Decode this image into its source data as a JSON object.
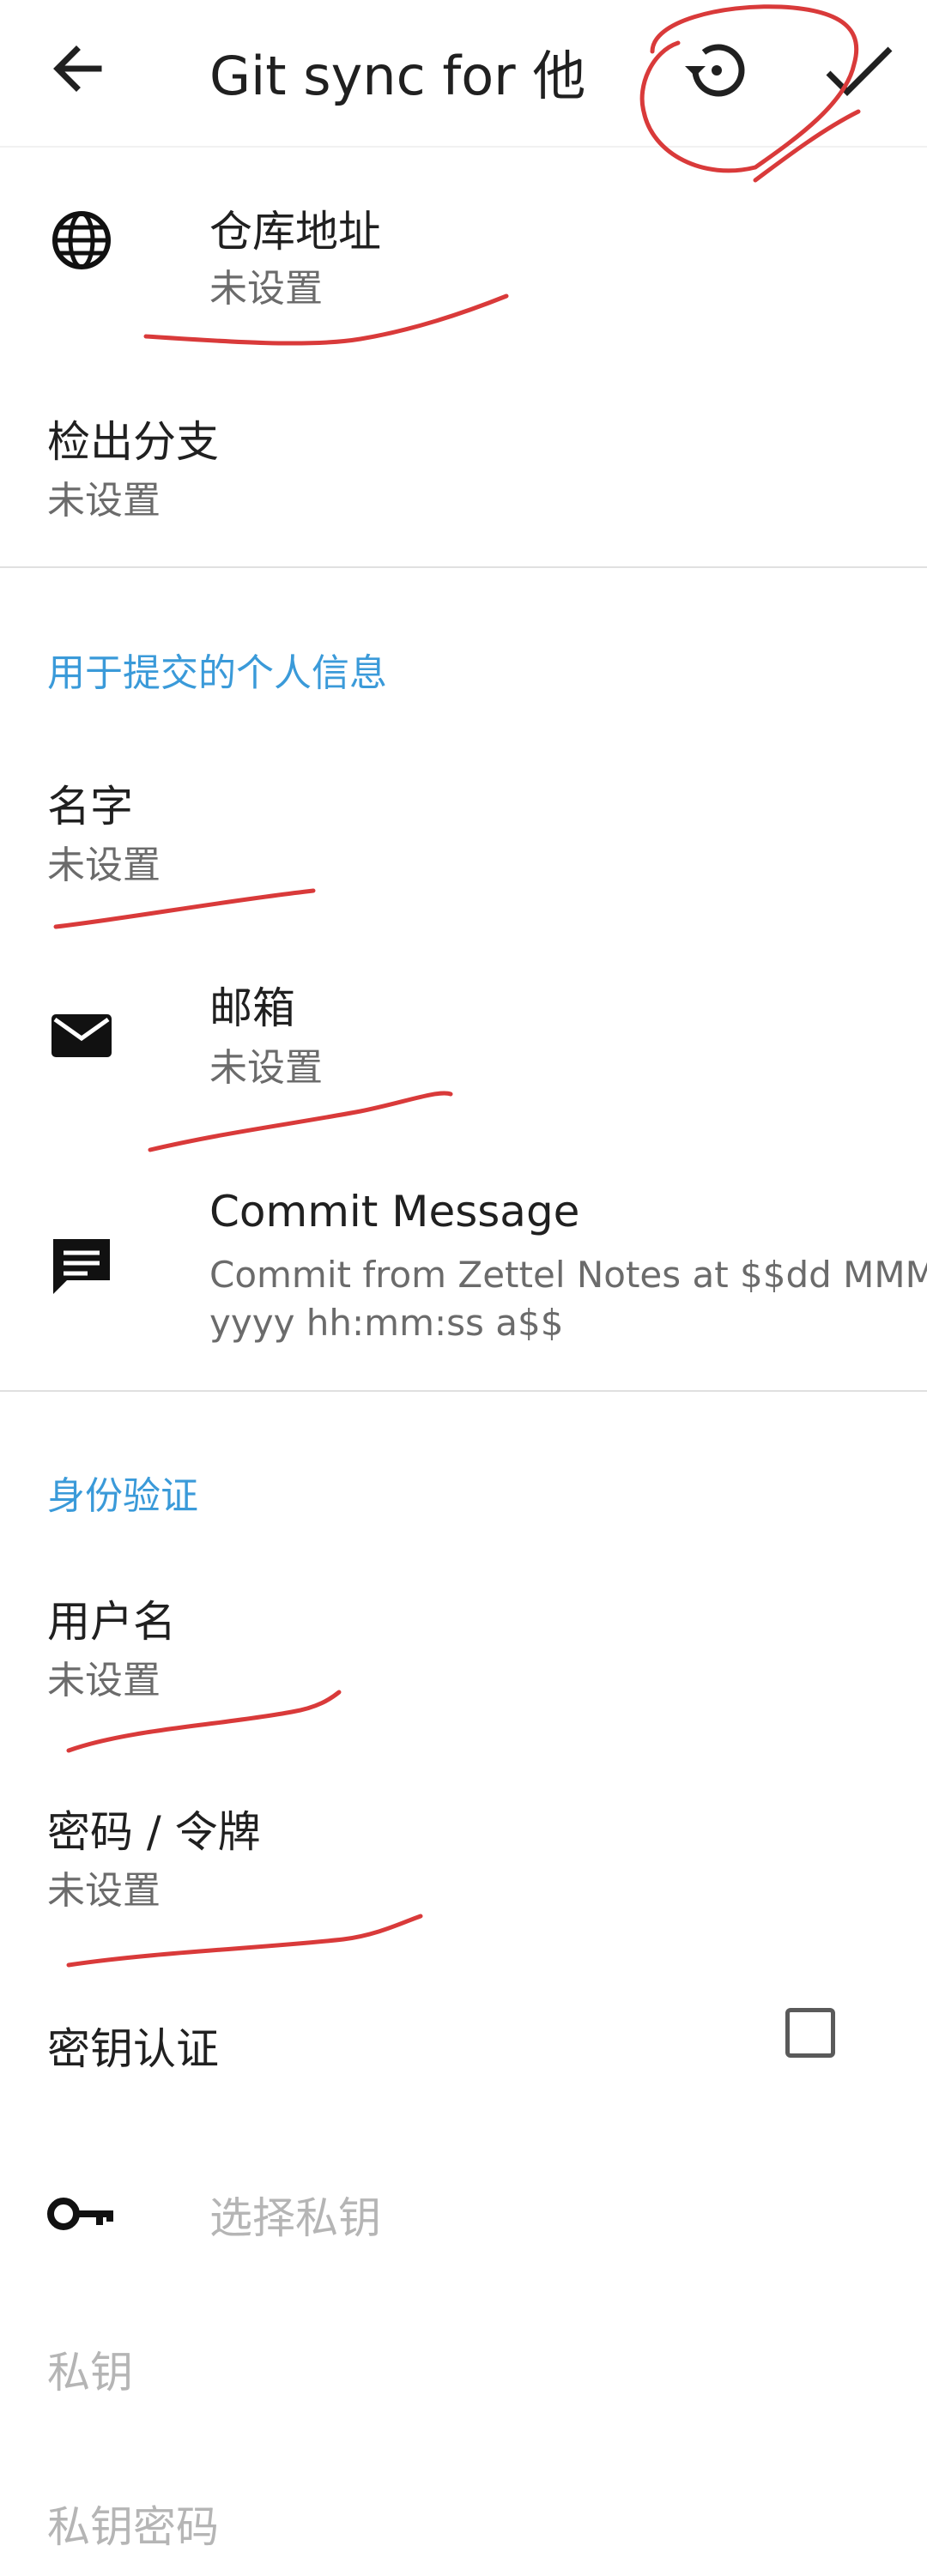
{
  "appbar": {
    "title": "Git sync for 他",
    "icons": [
      "back-arrow-icon",
      "history-icon",
      "check-icon"
    ]
  },
  "items": {
    "repo": {
      "title": "仓库地址",
      "value": "未设置"
    },
    "branch": {
      "title": "检出分支",
      "value": "未设置"
    },
    "name": {
      "title": "名字",
      "value": "未设置"
    },
    "email": {
      "title": "邮箱",
      "value": "未设置"
    },
    "commit": {
      "title": "Commit Message",
      "value": "Commit from Zettel Notes at $$dd MMM yyyy hh:mm:ss a$$"
    },
    "username": {
      "title": "用户名",
      "value": "未设置"
    },
    "password": {
      "title": "密码 / 令牌",
      "value": "未设置"
    },
    "keyauth": {
      "title": "密钥认证",
      "checked": false
    },
    "choose_key": {
      "title": "选择私钥"
    },
    "private_key": {
      "title": "私钥"
    },
    "key_password": {
      "title": "私钥密码"
    }
  },
  "sections": {
    "personal": "用于提交的个人信息",
    "auth": "身份验证"
  },
  "colors": {
    "accent": "#3a9ad9",
    "annotation": "#d93a3a",
    "disabled": "#b5b5b5"
  }
}
